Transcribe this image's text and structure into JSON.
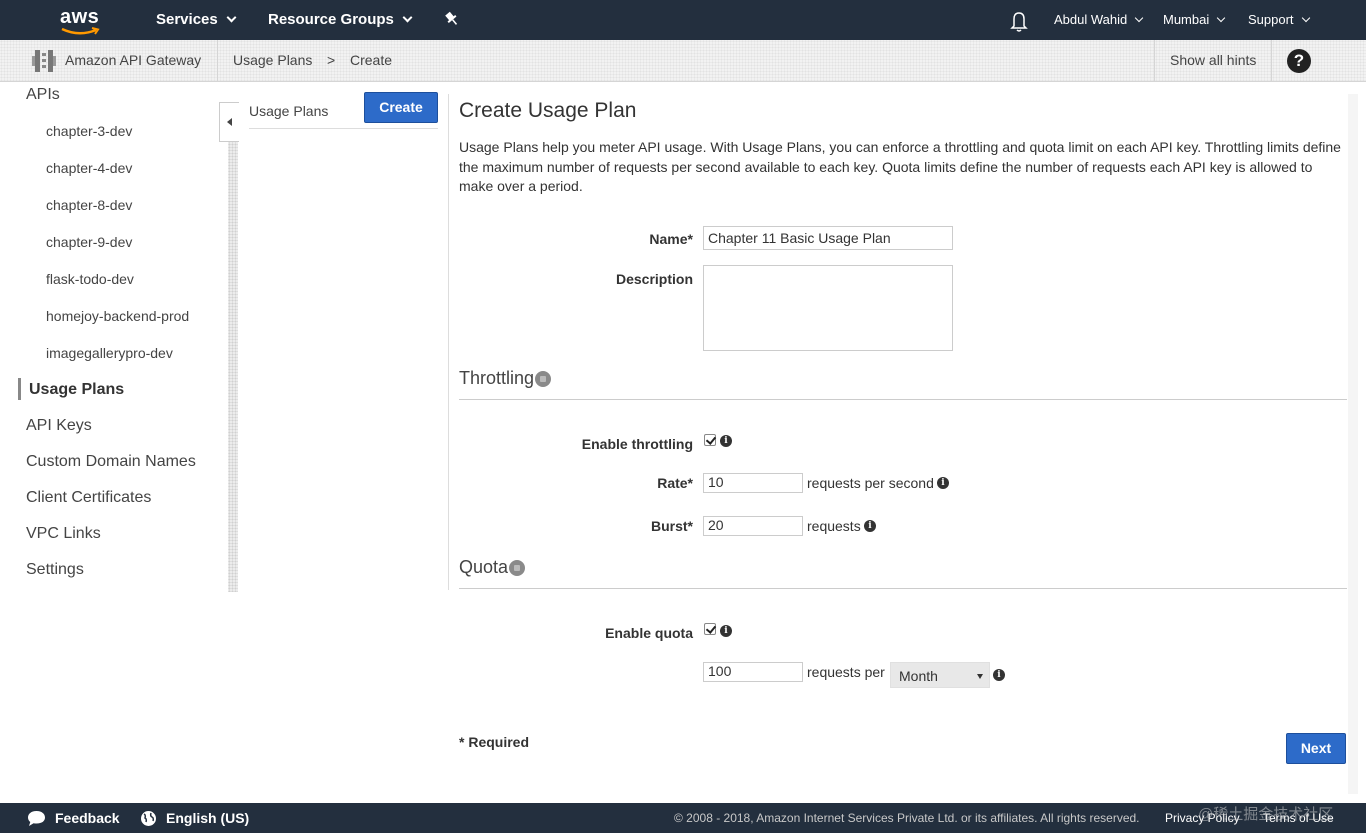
{
  "topnav": {
    "logo_text": "aws",
    "services": "Services",
    "resource_groups": "Resource Groups",
    "user": "Abdul Wahid",
    "region": "Mumbai",
    "support": "Support"
  },
  "breadcrumb": {
    "service": "Amazon API Gateway",
    "usage_plans": "Usage Plans",
    "separator": ">",
    "current": "Create",
    "show_hints": "Show all hints",
    "help_glyph": "?"
  },
  "sidebar": {
    "apis_header": "APIs",
    "apis": [
      "chapter-3-dev",
      "chapter-4-dev",
      "chapter-8-dev",
      "chapter-9-dev",
      "flask-todo-dev",
      "homejoy-backend-prod",
      "imagegallerypro-dev"
    ],
    "items": [
      "Usage Plans",
      "API Keys",
      "Custom Domain Names",
      "Client Certificates",
      "VPC Links",
      "Settings"
    ]
  },
  "middle": {
    "title": "Usage Plans",
    "create_button": "Create"
  },
  "form": {
    "title": "Create Usage Plan",
    "description": "Usage Plans help you meter API usage. With Usage Plans, you can enforce a throttling and quota limit on each API key. Throttling limits define the maximum number of requests per second available to each key. Quota limits define the number of requests each API key is allowed to make over a period.",
    "name_label": "Name*",
    "name_value": "Chapter 11 Basic Usage Plan",
    "description_label": "Description",
    "description_value": "",
    "throttling_title": "Throttling",
    "enable_throttling_label": "Enable throttling",
    "enable_throttling_checked": true,
    "rate_label": "Rate*",
    "rate_value": "10",
    "rate_unit": "requests per second",
    "burst_label": "Burst*",
    "burst_value": "20",
    "burst_unit": "requests",
    "quota_title": "Quota",
    "enable_quota_label": "Enable quota",
    "enable_quota_checked": true,
    "quota_value": "100",
    "quota_unit": "requests per",
    "quota_period": "Month",
    "required_note": "* Required",
    "next_button": "Next",
    "info_glyph": "i"
  },
  "footer": {
    "feedback": "Feedback",
    "language": "English (US)",
    "copyright": "© 2008 - 2018, Amazon Internet Services Private Ltd. or its affiliates. All rights reserved.",
    "privacy": "Privacy Policy",
    "terms": "Terms of Use",
    "watermark": "@稀土掘金技术社区"
  },
  "colors": {
    "nav_bg": "#232f3e",
    "primary_button": "#2d6bc9"
  }
}
